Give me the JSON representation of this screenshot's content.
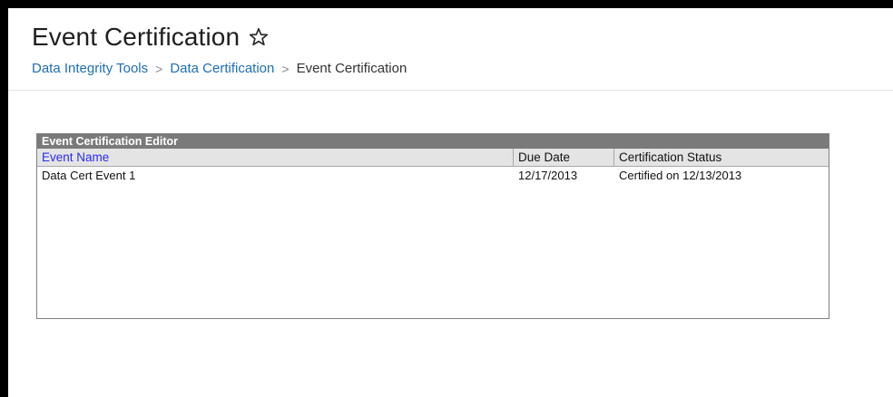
{
  "header": {
    "title": "Event Certification",
    "star_icon": "star-outline-icon",
    "breadcrumb": [
      {
        "label": "Data Integrity Tools"
      },
      {
        "label": "Data Certification"
      },
      {
        "label": "Event Certification"
      }
    ],
    "separator": ">"
  },
  "editor": {
    "title": "Event Certification Editor",
    "columns": [
      "Event Name",
      "Due Date",
      "Certification Status"
    ],
    "rows": [
      {
        "event_name": "Data Cert Event 1",
        "due_date": "12/17/2013",
        "status": "Certified on 12/13/2013"
      }
    ]
  },
  "colors": {
    "link": "#1d6fb5",
    "sortable_header": "#2a2aee",
    "panel_title_bg": "#7a7a7a",
    "column_header_bg": "#e4e4e4",
    "frame": "#000000"
  }
}
